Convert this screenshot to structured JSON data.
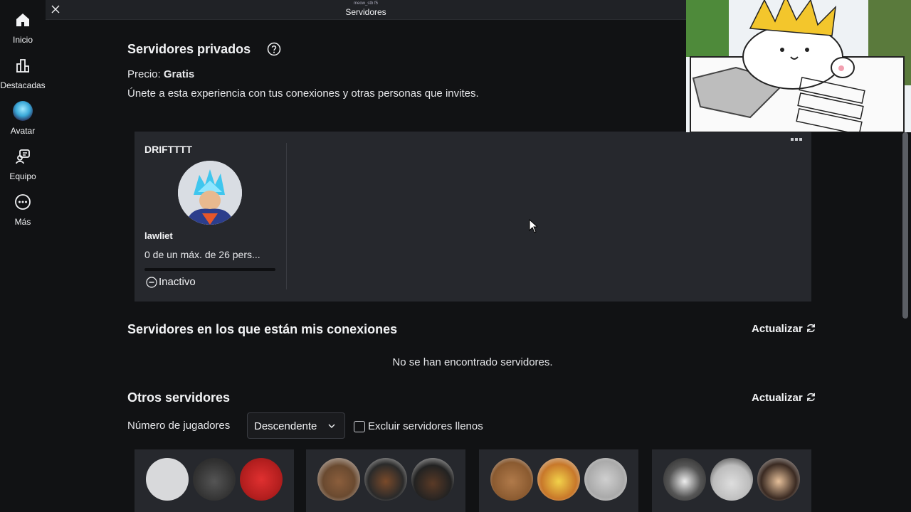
{
  "sidebar": {
    "items": [
      {
        "label": "Inicio",
        "icon": "home-icon"
      },
      {
        "label": "Destacadas",
        "icon": "chart-icon"
      },
      {
        "label": "Avatar",
        "icon": "avatar-icon"
      },
      {
        "label": "Equipo",
        "icon": "team-icon"
      },
      {
        "label": "Más",
        "icon": "more-icon"
      }
    ]
  },
  "topbar": {
    "small_text": "meow_stb f5",
    "title": "Servidores"
  },
  "private": {
    "heading": "Servidores privados",
    "price_label": "Precio:",
    "price_value": "Gratis",
    "description": "Únete a esta experiencia con tus conexiones y otras personas que invites.",
    "server_name": "DRIFTTTT",
    "owner": "lawliet",
    "players": "0 de un máx. de 26 pers...",
    "status": "Inactivo",
    "fill": 0
  },
  "friends": {
    "heading": "Servidores en los que están mis conexiones",
    "refresh": "Actualizar",
    "empty": "No se han encontrado servidores."
  },
  "other": {
    "heading": "Otros servidores",
    "refresh": "Actualizar",
    "sort_label": "Número de jugadores",
    "sort_value": "Descendente",
    "exclude_label": "Excluir servidores llenos"
  },
  "colors": {
    "background": "#111214",
    "card": "#26282d",
    "text": "#f2f3f5"
  }
}
